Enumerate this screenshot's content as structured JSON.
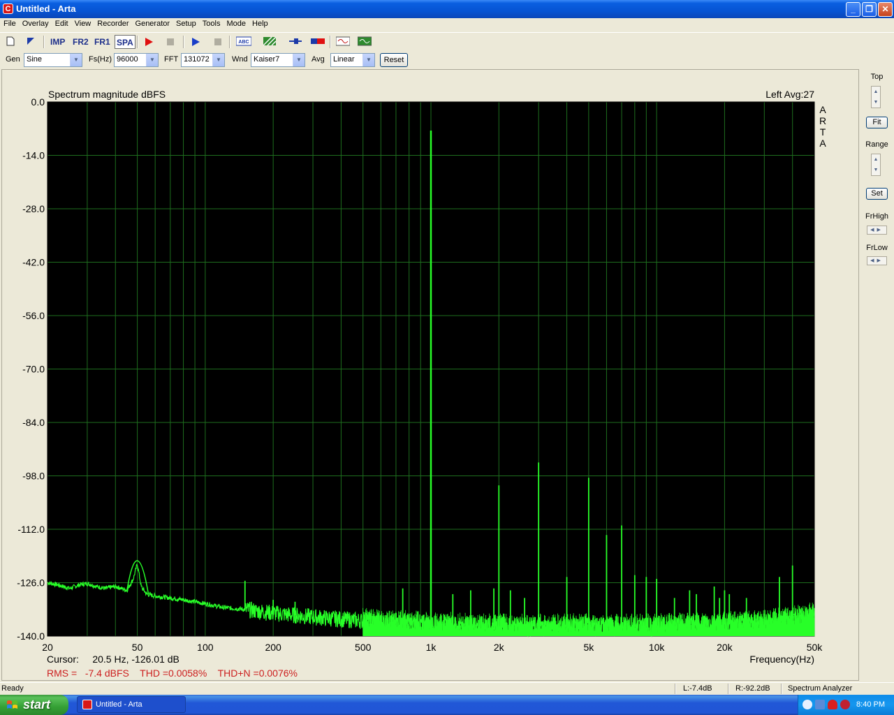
{
  "window": {
    "title": "Untitled - Arta",
    "app_icon_letter": "C",
    "controls": {
      "minimize": "_",
      "maximize": "❐",
      "close": "✕"
    }
  },
  "menu": [
    "File",
    "Overlay",
    "Edit",
    "View",
    "Recorder",
    "Generator",
    "Setup",
    "Tools",
    "Mode",
    "Help"
  ],
  "toolbar": {
    "imp": "IMP",
    "fr2": "FR2",
    "fr1": "FR1",
    "spa": "SPA",
    "abc": "ABC"
  },
  "controls_row": {
    "gen_label": "Gen",
    "gen_value": "Sine",
    "fs_label": "Fs(Hz)",
    "fs_value": "96000",
    "fft_label": "FFT",
    "fft_value": "131072",
    "wnd_label": "Wnd",
    "wnd_value": "Kaiser7",
    "avg_label": "Avg",
    "avg_value": "Linear",
    "reset_label": "Reset"
  },
  "right_panel": {
    "top_label": "Top",
    "fit_label": "Fit",
    "range_label": "Range",
    "set_label": "Set",
    "frhigh_label": "FrHigh",
    "frlow_label": "FrLow"
  },
  "cursor_text": "Cursor:     20.5 Hz, -126.01 dB",
  "measure_text": "RMS =   -7.4 dBFS    THD =0.0058%    THD+N =0.0076%",
  "status": {
    "left": "Ready",
    "l_level": "L:-7.4dB",
    "r_level": "R:-92.2dB",
    "mode": "Spectrum Analyzer"
  },
  "taskbar": {
    "start": "start",
    "task_item": "Untitled - Arta",
    "clock": "8:40 PM"
  },
  "colors": {
    "plot_bg": "#000000",
    "grid": "#1e6e1e",
    "trace": "#28ff28",
    "measure_text": "#cc1e1e"
  },
  "chart_data": {
    "type": "line",
    "title": "Spectrum magnitude dBFS",
    "title_right": "Left  Avg:27",
    "side_label": [
      "A",
      "R",
      "T",
      "A"
    ],
    "xlabel": "Frequency(Hz)",
    "x_scale": "log",
    "xlim": [
      20,
      50000
    ],
    "ylim": [
      -140,
      0
    ],
    "yticks": [
      0,
      -14,
      -28,
      -42,
      -56,
      -70,
      -84,
      -98,
      -112,
      -126,
      -140
    ],
    "ytick_labels": [
      "0.0",
      "-14.0",
      "-28.0",
      "-42.0",
      "-56.0",
      "-70.0",
      "-84.0",
      "-98.0",
      "-112.0",
      "-126.0",
      "-140.0"
    ],
    "xticks": [
      20,
      50,
      100,
      200,
      500,
      1000,
      2000,
      5000,
      10000,
      20000,
      50000
    ],
    "xtick_labels": [
      "20",
      "50",
      "100",
      "200",
      "500",
      "1k",
      "2k",
      "5k",
      "10k",
      "20k",
      "50k"
    ],
    "noise_floor": {
      "x": [
        20,
        22,
        25,
        28,
        30,
        33,
        36,
        40,
        45,
        48,
        50,
        52,
        55,
        60,
        70,
        80,
        90,
        100,
        120,
        150,
        200,
        300,
        500,
        700,
        1000,
        2000,
        5000,
        10000,
        20000,
        30000,
        40000,
        50000
      ],
      "y": [
        -126,
        -126.5,
        -127.5,
        -126.5,
        -126.2,
        -127,
        -127.5,
        -127,
        -128,
        -125,
        -121,
        -127,
        -129,
        -129.5,
        -130,
        -130.5,
        -131,
        -131.5,
        -132.5,
        -133,
        -134,
        -135,
        -136,
        -136.5,
        -137,
        -137.5,
        -137.5,
        -137.5,
        -137,
        -136.5,
        -135.5,
        -134.5
      ]
    },
    "peaks": [
      {
        "x": 50,
        "y": -121
      },
      {
        "x": 150,
        "y": -125.5
      },
      {
        "x": 200,
        "y": -130.5
      },
      {
        "x": 250,
        "y": -131
      },
      {
        "x": 750,
        "y": -127.5
      },
      {
        "x": 1000,
        "y": -7.5
      },
      {
        "x": 1250,
        "y": -129
      },
      {
        "x": 1500,
        "y": -128
      },
      {
        "x": 1900,
        "y": -127.5
      },
      {
        "x": 2000,
        "y": -100.5
      },
      {
        "x": 2250,
        "y": -128
      },
      {
        "x": 2600,
        "y": -130
      },
      {
        "x": 3000,
        "y": -94.5
      },
      {
        "x": 4000,
        "y": -124.5
      },
      {
        "x": 5000,
        "y": -98.5
      },
      {
        "x": 6000,
        "y": -113.5
      },
      {
        "x": 7000,
        "y": -111
      },
      {
        "x": 8000,
        "y": -124
      },
      {
        "x": 9000,
        "y": -124.5
      },
      {
        "x": 10000,
        "y": -125
      },
      {
        "x": 12000,
        "y": -130
      },
      {
        "x": 14000,
        "y": -128
      },
      {
        "x": 15000,
        "y": -129
      },
      {
        "x": 18000,
        "y": -127
      },
      {
        "x": 19000,
        "y": -130
      },
      {
        "x": 20000,
        "y": -128
      },
      {
        "x": 21000,
        "y": -129
      },
      {
        "x": 25000,
        "y": -130
      },
      {
        "x": 35000,
        "y": -124.5
      },
      {
        "x": 40000,
        "y": -121.5
      }
    ]
  }
}
